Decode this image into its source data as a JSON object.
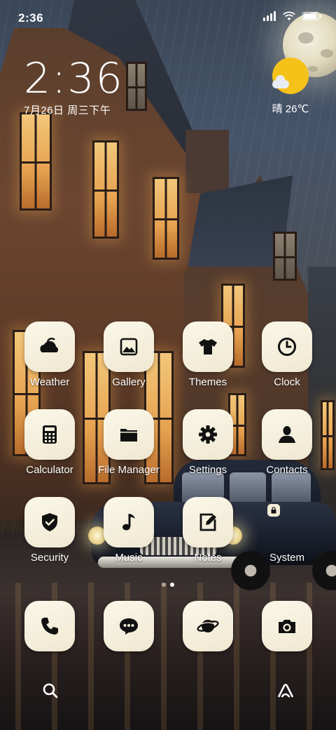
{
  "status_bar": {
    "time": "2:36"
  },
  "clock_widget": {
    "time": "2:36",
    "date": "7月26日 周三下午"
  },
  "weather_widget": {
    "condition_temp": "晴 26℃",
    "icon": "sunny-partly-cloudy-icon",
    "accent_color": "#f6c21a"
  },
  "apps": [
    {
      "label": "Weather",
      "icon": "weather-icon"
    },
    {
      "label": "Gallery",
      "icon": "gallery-icon"
    },
    {
      "label": "Themes",
      "icon": "themes-tshirt-icon"
    },
    {
      "label": "Clock",
      "icon": "clock-icon"
    },
    {
      "label": "Calculator",
      "icon": "calculator-icon"
    },
    {
      "label": "File Manager",
      "icon": "folder-icon"
    },
    {
      "label": "Settings",
      "icon": "gear-icon"
    },
    {
      "label": "Contacts",
      "icon": "contact-person-icon"
    },
    {
      "label": "Security",
      "icon": "shield-check-icon"
    },
    {
      "label": "Music",
      "icon": "music-note-icon"
    },
    {
      "label": "Notes",
      "icon": "notes-pencil-icon"
    },
    {
      "label": "System",
      "icon": "folder-apps"
    }
  ],
  "dock": [
    {
      "icon": "phone-icon"
    },
    {
      "icon": "messages-icon"
    },
    {
      "icon": "browser-planet-icon"
    },
    {
      "icon": "camera-icon"
    }
  ],
  "bottom_bar": {
    "left_icon": "search-icon",
    "right_icon": "gesture-a-icon"
  },
  "page_indicator": {
    "current": 2,
    "total": 2
  },
  "theme": {
    "icon_tile_color": "#f4eedb",
    "icon_glyph_color": "#111111"
  }
}
